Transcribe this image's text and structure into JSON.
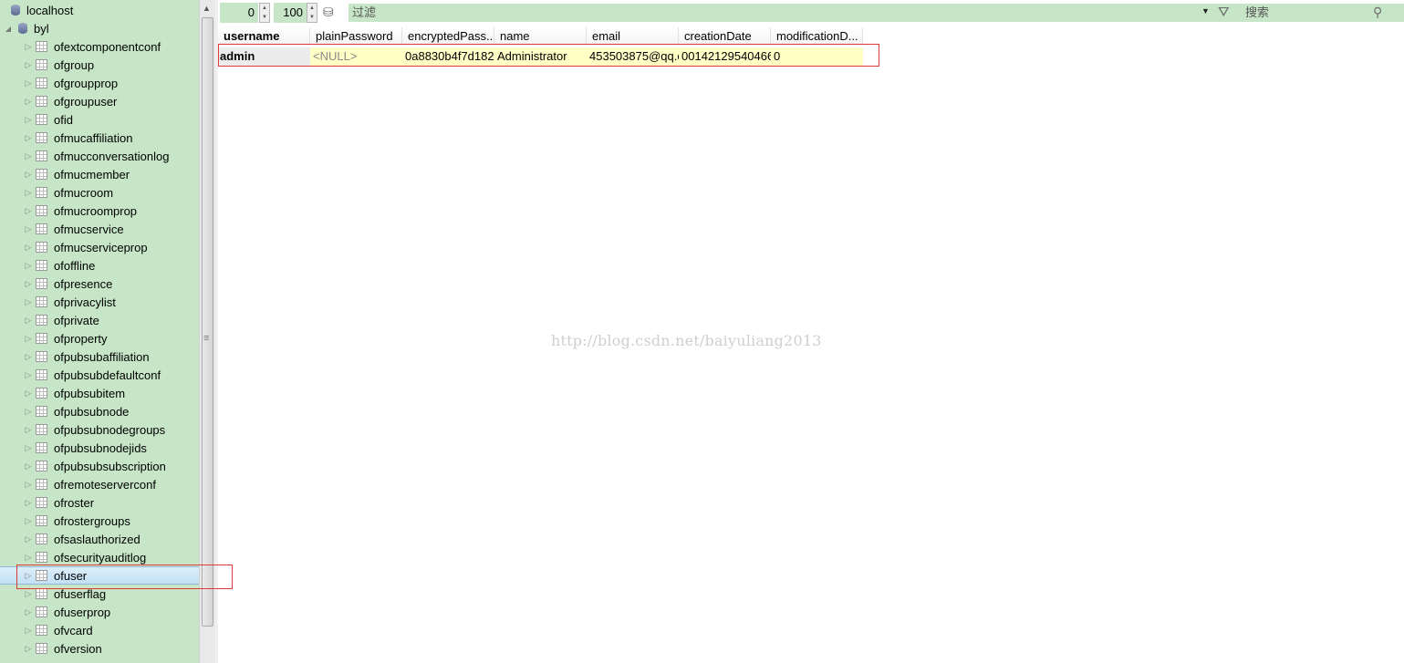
{
  "tree": {
    "server": "localhost",
    "database": "byl",
    "tables": [
      "ofextcomponentconf",
      "ofgroup",
      "ofgroupprop",
      "ofgroupuser",
      "ofid",
      "ofmucaffiliation",
      "ofmucconversationlog",
      "ofmucmember",
      "ofmucroom",
      "ofmucroomprop",
      "ofmucservice",
      "ofmucserviceprop",
      "ofoffline",
      "ofpresence",
      "ofprivacylist",
      "ofprivate",
      "ofproperty",
      "ofpubsubaffiliation",
      "ofpubsubdefaultconf",
      "ofpubsubitem",
      "ofpubsubnode",
      "ofpubsubnodegroups",
      "ofpubsubnodejids",
      "ofpubsubsubscription",
      "ofremoteserverconf",
      "ofroster",
      "ofrostergroups",
      "ofsaslauthorized",
      "ofsecurityauditlog",
      "ofuser",
      "ofuserflag",
      "ofuserprop",
      "ofvcard",
      "ofversion"
    ],
    "selected_table": "ofuser"
  },
  "toolbar": {
    "offset": "0",
    "limit": "100",
    "filter_placeholder": "过滤",
    "search_placeholder": "搜索"
  },
  "grid": {
    "columns": [
      "username",
      "plainPassword",
      "encryptedPass...",
      "name",
      "email",
      "creationDate",
      "modificationD..."
    ],
    "sorted_column": "username",
    "rows": [
      [
        "admin",
        "<NULL>",
        "0a8830b4f7d182",
        "Administrator",
        "453503875@qq.c",
        "00142129540466",
        "0"
      ]
    ]
  },
  "watermark": "http://blog.csdn.net/baiyuliang2013",
  "colors": {
    "panel_green": "#c7e6c7",
    "row_highlight": "#ffffc6",
    "annotation_red": "#e03b3b",
    "selection_blue": "#c3e0f5"
  }
}
